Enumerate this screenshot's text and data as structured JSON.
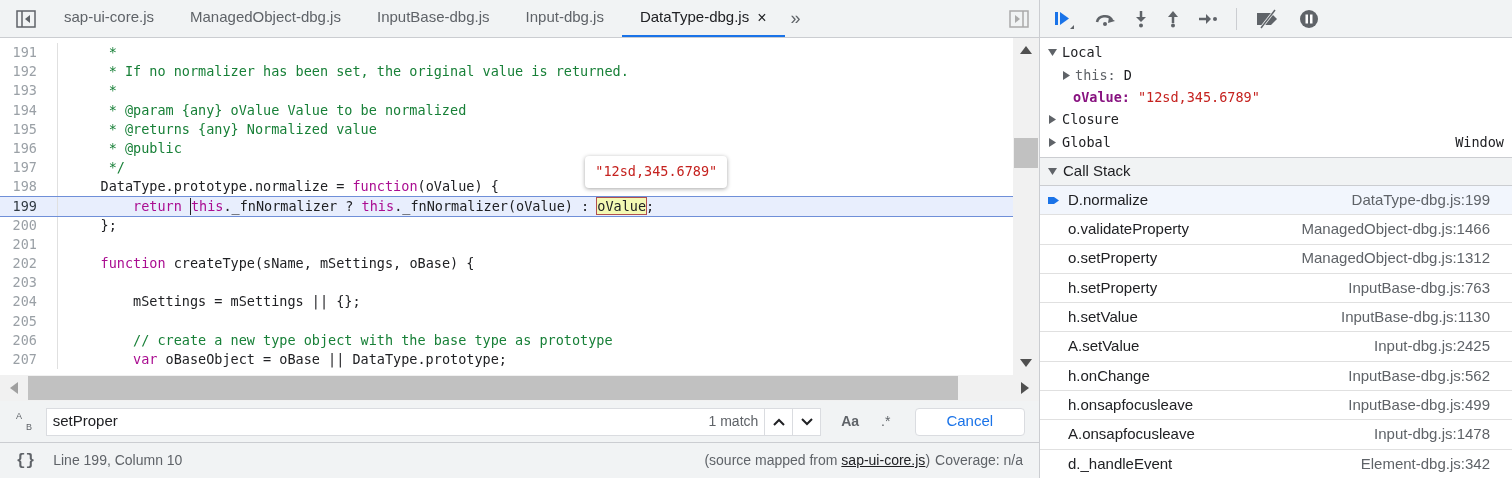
{
  "editor_tabs": [
    {
      "label": "sap-ui-core.js",
      "selected": false
    },
    {
      "label": "ManagedObject-dbg.js",
      "selected": false
    },
    {
      "label": "InputBase-dbg.js",
      "selected": false
    },
    {
      "label": "Input-dbg.js",
      "selected": false
    },
    {
      "label": "DataType-dbg.js",
      "selected": true,
      "close": "×"
    }
  ],
  "more_tabs": "»",
  "code_lines": [
    {
      "number": "191",
      "current": false,
      "tokens": [
        {
          "kind": "comment",
          "text": "     *"
        }
      ]
    },
    {
      "number": "192",
      "current": false,
      "tokens": [
        {
          "kind": "comment",
          "text": "     * If no normalizer has been set, the original value is returned."
        }
      ]
    },
    {
      "number": "193",
      "current": false,
      "tokens": [
        {
          "kind": "comment",
          "text": "     *"
        }
      ]
    },
    {
      "number": "194",
      "current": false,
      "tokens": [
        {
          "kind": "comment",
          "text": "     * @param {any} oValue Value to be normalized"
        }
      ]
    },
    {
      "number": "195",
      "current": false,
      "tokens": [
        {
          "kind": "comment",
          "text": "     * @returns {any} Normalized value"
        }
      ]
    },
    {
      "number": "196",
      "current": false,
      "tokens": [
        {
          "kind": "comment",
          "text": "     * @public"
        }
      ]
    },
    {
      "number": "197",
      "current": false,
      "tokens": [
        {
          "kind": "comment",
          "text": "     */"
        }
      ]
    },
    {
      "number": "198",
      "current": false,
      "tokens": [
        {
          "kind": "plain",
          "text": "    DataType.prototype.normalize = "
        },
        {
          "kind": "keyword",
          "text": "function"
        },
        {
          "kind": "plain",
          "text": "(oValue) {"
        }
      ]
    },
    {
      "number": "199",
      "current": true,
      "tokens": [
        {
          "kind": "keyword",
          "text": "        return "
        },
        {
          "kind": "caret"
        },
        {
          "kind": "keyword",
          "text": "this"
        },
        {
          "kind": "plain",
          "text": "._fnNormalizer ? "
        },
        {
          "kind": "keyword",
          "text": "this"
        },
        {
          "kind": "plain",
          "text": "._fnNormalizer(oValue) : "
        },
        {
          "kind": "hover",
          "text": "oValue",
          "tooltip": "\"12sd,345.6789\""
        },
        {
          "kind": "plain",
          "text": ";"
        }
      ]
    },
    {
      "number": "200",
      "current": false,
      "tokens": [
        {
          "kind": "plain",
          "text": "    };"
        }
      ]
    },
    {
      "number": "201",
      "current": false
    },
    {
      "number": "202",
      "current": false,
      "tokens": [
        {
          "kind": "keyword",
          "text": "    function"
        },
        {
          "kind": "plain",
          "text": " createType(sName, mSettings, oBase) {"
        }
      ]
    },
    {
      "number": "203",
      "current": false
    },
    {
      "number": "204",
      "current": false,
      "tokens": [
        {
          "kind": "plain",
          "text": "        mSettings = mSettings || {};"
        }
      ]
    },
    {
      "number": "205",
      "current": false
    },
    {
      "number": "206",
      "current": false,
      "tokens": [
        {
          "kind": "comment",
          "text": "        // create a new type object with the base type as prototype"
        }
      ]
    },
    {
      "number": "207",
      "current": false,
      "tokens": [
        {
          "kind": "keyword",
          "text": "        var"
        },
        {
          "kind": "plain",
          "text": " oBaseObject = oBase || DataType.prototype;"
        }
      ]
    }
  ],
  "search": {
    "replace_toggle": [
      "A",
      "B"
    ],
    "value": "setProper",
    "matches": "1 match",
    "match_case": "Aa",
    "regex": ".*",
    "cancel": "Cancel"
  },
  "status_bar": {
    "format_icon": "{}",
    "position": "Line 199, Column 10",
    "source_prefix": "(source mapped from ",
    "source_link": "sap-ui-core.js",
    "source_suffix": ")",
    "coverage": "Coverage: n/a"
  },
  "scope": [
    {
      "name": "Local",
      "expanded": true,
      "children": [
        {
          "name": "this:",
          "value": "D",
          "kind": "object"
        },
        {
          "name": "oValue:",
          "value": "\"12sd,345.6789\"",
          "kind": "string"
        }
      ]
    },
    {
      "name": "Closure",
      "expanded": false
    },
    {
      "name": "Global",
      "expanded": false,
      "value": "Window"
    }
  ],
  "call_stack": {
    "title": "Call Stack",
    "expanded": true,
    "frames": [
      {
        "function": "D.normalize",
        "location": "DataType-dbg.js:199",
        "selected": true
      },
      {
        "function": "o.validateProperty",
        "location": "ManagedObject-dbg.js:1466",
        "selected": false
      },
      {
        "function": "o.setProperty",
        "location": "ManagedObject-dbg.js:1312",
        "selected": false
      },
      {
        "function": "h.setProperty",
        "location": "InputBase-dbg.js:763",
        "selected": false
      },
      {
        "function": "h.setValue",
        "location": "InputBase-dbg.js:1130",
        "selected": false
      },
      {
        "function": "A.setValue",
        "location": "Input-dbg.js:2425",
        "selected": false
      },
      {
        "function": "h.onChange",
        "location": "InputBase-dbg.js:562",
        "selected": false
      },
      {
        "function": "h.onsapfocusleave",
        "location": "InputBase-dbg.js:499",
        "selected": false
      },
      {
        "function": "A.onsapfocusleave",
        "location": "Input-dbg.js:1478",
        "selected": false
      },
      {
        "function": "d._handleEvent",
        "location": "Element-dbg.js:342",
        "selected": false
      }
    ]
  }
}
